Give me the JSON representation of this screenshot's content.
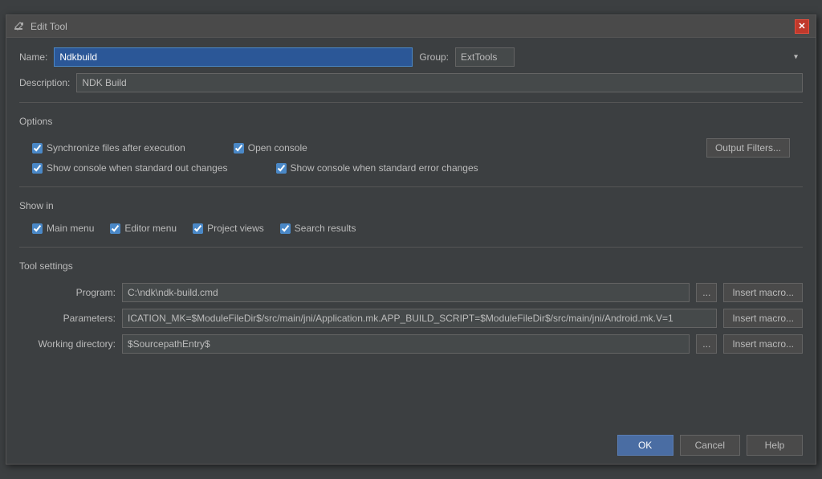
{
  "dialog": {
    "title": "Edit Tool",
    "title_icon": "✎",
    "close_icon": "✕"
  },
  "fields": {
    "name_label": "Name:",
    "name_value": "Ndkbuild",
    "group_label": "Group:",
    "group_value": "ExtTools",
    "group_options": [
      "ExtTools"
    ],
    "description_label": "Description:",
    "description_value": "NDK Build"
  },
  "sections": {
    "options_label": "Options",
    "show_in_label": "Show in",
    "tool_settings_label": "Tool settings"
  },
  "options": {
    "sync_files": {
      "label": "Synchronize files after execution",
      "checked": true
    },
    "open_console": {
      "label": "Open console",
      "checked": true
    },
    "show_console_out": {
      "label": "Show console when standard out changes",
      "checked": true
    },
    "show_console_err": {
      "label": "Show console when standard error changes",
      "checked": true
    },
    "output_filters_btn": "Output Filters..."
  },
  "show_in": {
    "main_menu": {
      "label": "Main menu",
      "checked": true
    },
    "editor_menu": {
      "label": "Editor menu",
      "checked": true
    },
    "project_views": {
      "label": "Project views",
      "checked": true
    },
    "search_results": {
      "label": "Search results",
      "checked": true
    }
  },
  "tool_settings": {
    "program_label": "Program:",
    "program_value": "C:\\ndk\\ndk-build.cmd",
    "program_ellipsis": "...",
    "program_macro_btn": "Insert macro...",
    "parameters_label": "Parameters:",
    "parameters_value": "ICATION_MK=$ModuleFileDir$/src/main/jni/Application.mk.APP_BUILD_SCRIPT=$ModuleFileDir$/src/main/jni/Android.mk.V=1",
    "parameters_macro_btn": "Insert macro...",
    "working_dir_label": "Working directory:",
    "working_dir_value": "$SourcepathEntry$",
    "working_dir_ellipsis": "...",
    "working_dir_macro_btn": "Insert macro..."
  },
  "footer": {
    "ok_label": "OK",
    "cancel_label": "Cancel",
    "help_label": "Help"
  }
}
